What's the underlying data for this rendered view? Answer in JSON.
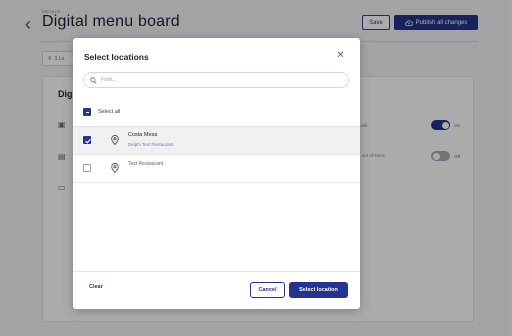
{
  "page": {
    "breadcrumb": "MENUS",
    "title": "Digital menu board",
    "save_label": "Save",
    "publish_label": "Publish all changes",
    "chip_label": "1 Lo"
  },
  "background_card": {
    "title": "Digi",
    "rows": [
      {
        "text": "of stock",
        "toggle_state": "On"
      },
      {
        "text": "mes out of stock",
        "toggle_state": "Off"
      }
    ]
  },
  "modal": {
    "title": "Select locations",
    "search_placeholder": "Find...",
    "select_all_label": "Select all",
    "locations": [
      {
        "name": "Costa Mesa",
        "subtitle": "Delphi Test Restaurant",
        "checked": true
      },
      {
        "name": "Test Restaurant",
        "subtitle": "",
        "checked": false
      }
    ],
    "clear_label": "Clear",
    "cancel_label": "Cancel",
    "select_label": "Select location"
  },
  "colors": {
    "accent": "#25348e",
    "overlay": "rgba(0,0,0,0.33)"
  }
}
